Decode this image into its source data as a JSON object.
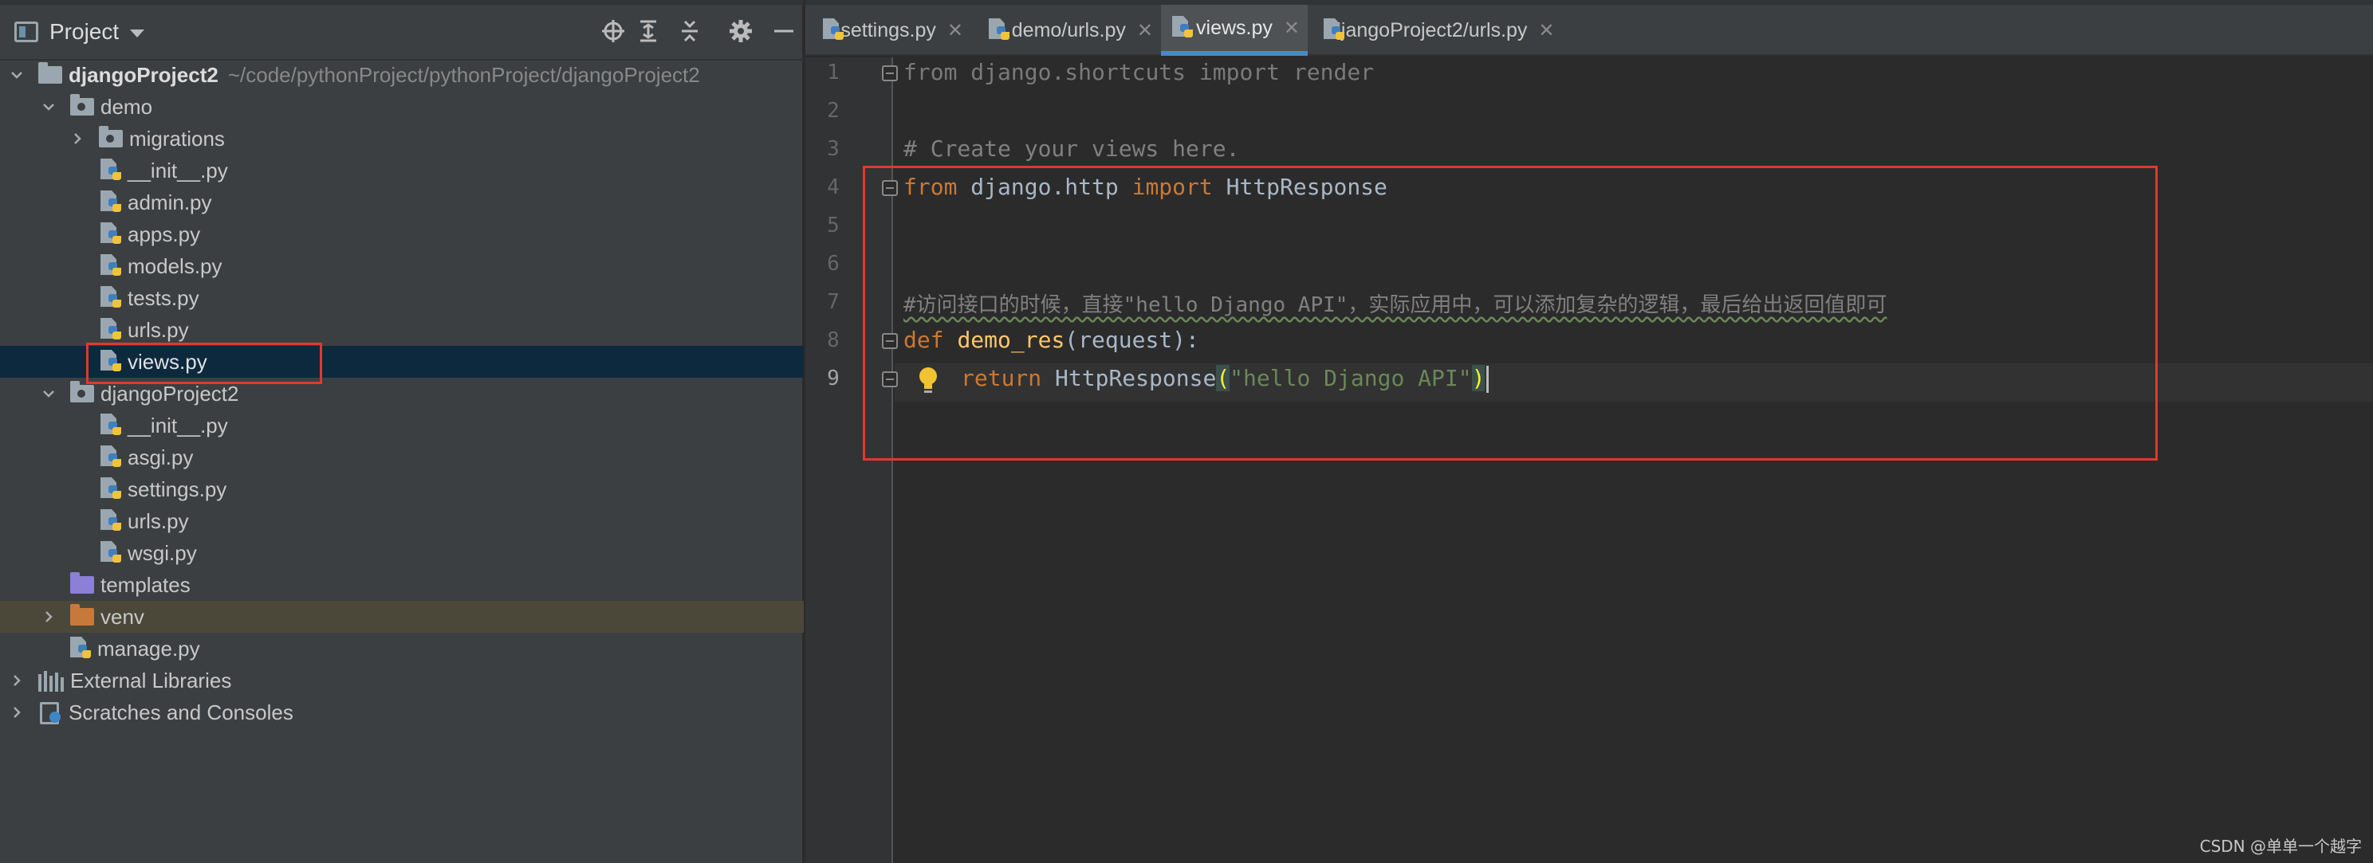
{
  "project_panel": {
    "title": "Project",
    "toolbar_icons": [
      "locate-icon",
      "expand-all-icon",
      "collapse-all-icon",
      "gear-icon",
      "minimize-icon"
    ],
    "tree": [
      {
        "label": "djangoProject2",
        "path": "~/code/pythonProject/pythonProject/djangoProject2",
        "type": "folder",
        "expanded": true
      },
      {
        "label": "demo",
        "type": "package",
        "expanded": true
      },
      {
        "label": "migrations",
        "type": "package",
        "expanded": false
      },
      {
        "label": "__init__.py",
        "type": "python-file"
      },
      {
        "label": "admin.py",
        "type": "python-file"
      },
      {
        "label": "apps.py",
        "type": "python-file"
      },
      {
        "label": "models.py",
        "type": "python-file"
      },
      {
        "label": "tests.py",
        "type": "python-file"
      },
      {
        "label": "urls.py",
        "type": "python-file"
      },
      {
        "label": "views.py",
        "type": "python-file",
        "selected": true
      },
      {
        "label": "djangoProject2",
        "type": "package",
        "expanded": true
      },
      {
        "label": "__init__.py",
        "type": "python-file"
      },
      {
        "label": "asgi.py",
        "type": "python-file"
      },
      {
        "label": "settings.py",
        "type": "python-file"
      },
      {
        "label": "urls.py",
        "type": "python-file"
      },
      {
        "label": "wsgi.py",
        "type": "python-file"
      },
      {
        "label": "templates",
        "type": "templates-folder"
      },
      {
        "label": "venv",
        "type": "excluded-folder",
        "expanded": false
      },
      {
        "label": "manage.py",
        "type": "python-file"
      },
      {
        "label": "External Libraries",
        "type": "libraries",
        "expanded": false
      },
      {
        "label": "Scratches and Consoles",
        "type": "scratches",
        "expanded": false
      }
    ]
  },
  "tabs": [
    {
      "label": "settings.py",
      "active": false
    },
    {
      "label": "demo/urls.py",
      "active": false
    },
    {
      "label": "views.py",
      "active": true
    },
    {
      "label": "djangoProject2/urls.py",
      "active": false
    }
  ],
  "editor": {
    "line_numbers": [
      "1",
      "2",
      "3",
      "4",
      "5",
      "6",
      "7",
      "8",
      "9"
    ],
    "current_line": "9",
    "line1": {
      "kw": "from",
      "mod": " django.shortcuts ",
      "kw2": "import",
      "name": " render"
    },
    "line3": "# Create your views here.",
    "line4": {
      "kw": "from",
      "mod": " django.http ",
      "kw2": "import",
      "name": " HttpResponse"
    },
    "line7": "#访问接口的时候，直接\"hello Django API\"，实际应用中，可以添加复杂的逻辑，最后给出返回值即可",
    "line8": {
      "kw": "def",
      "fn": "demo_res",
      "params": "(request):"
    },
    "line9": {
      "kw": "return",
      "call": " HttpResponse",
      "open": "(",
      "str": "\"hello Django API\"",
      "close": ")"
    }
  },
  "colors": {
    "keyword": "#cc7832",
    "function": "#ffc66d",
    "string": "#6a8759",
    "comment": "#808080",
    "highlight_box": "#e0392c",
    "active_tab_underline": "#4a88c7"
  },
  "watermark": "CSDN @单单一个越字"
}
